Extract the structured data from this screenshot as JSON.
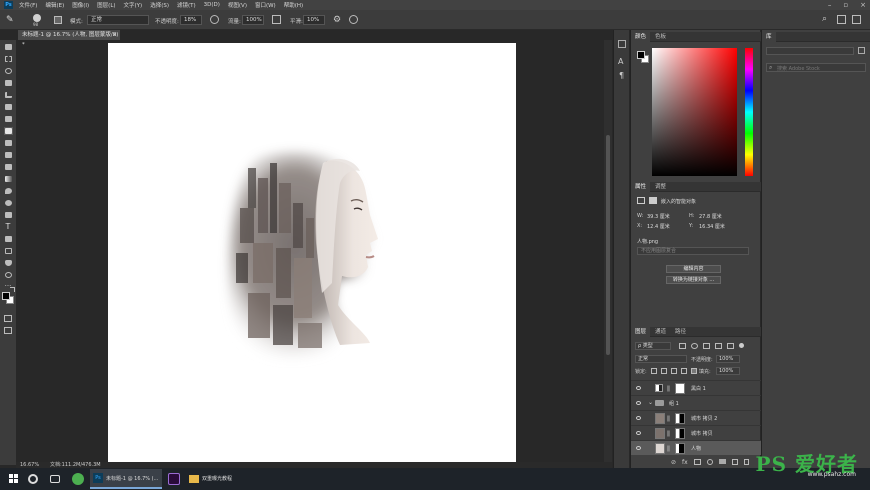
{
  "menubar": {
    "items": [
      "文件(F)",
      "编辑(E)",
      "图像(I)",
      "图层(L)",
      "文字(Y)",
      "选择(S)",
      "滤镜(T)",
      "3D(D)",
      "视图(V)",
      "窗口(W)",
      "帮助(H)"
    ]
  },
  "options": {
    "mode_label": "模式:",
    "mode_value": "正常",
    "opacity_label": "不透明度:",
    "opacity_value": "18%",
    "flow_label": "流量:",
    "flow_value": "100%",
    "smooth_label": "平滑:",
    "smooth_value": "10%",
    "brush_size": "98"
  },
  "document": {
    "tab_title": "未标题-1 @ 16.7% (人物, 图层蒙版/8) *",
    "status_zoom": "16.67%",
    "status_doc": "文档:111.2M/476.3M"
  },
  "color_panel": {
    "tabs": [
      "颜色",
      "色板"
    ]
  },
  "properties_panel": {
    "tabs": [
      "属性",
      "调整"
    ],
    "type_label": "嵌入的智能对象",
    "w_label": "W:",
    "w_value": "39.3 厘米",
    "h_label": "H:",
    "h_value": "27.8 厘米",
    "x_label": "X:",
    "x_value": "12.4 厘米",
    "y_label": "Y:",
    "y_value": "16.34 厘米",
    "file_name": "人物.png",
    "comp_placeholder": "不应用图层复合",
    "edit_button": "编辑内容",
    "convert_button": "转换为链接对象 ..."
  },
  "layers_panel": {
    "tabs": [
      "图层",
      "通道",
      "路径"
    ],
    "filter_kind": "ρ 类型",
    "blend_mode": "正常",
    "opacity_label": "不透明度:",
    "opacity_value": "100%",
    "lock_label": "锁定:",
    "fill_label": "填充:",
    "fill_value": "100%",
    "layers": [
      {
        "name": "黑白 1"
      },
      {
        "name": "组 1"
      },
      {
        "name": "城市 拷贝 2"
      },
      {
        "name": "城市 拷贝"
      },
      {
        "name": "人物"
      }
    ]
  },
  "right_panel": {
    "tab": "库",
    "search_placeholder": "搜索 Adobe Stock"
  },
  "taskbar": {
    "task_label": "未标题-1 @ 16.7% (...",
    "folder_label": "双重曝光教程"
  },
  "watermark": {
    "brand": "PS 爱好者",
    "url": "www.psahz.com"
  }
}
